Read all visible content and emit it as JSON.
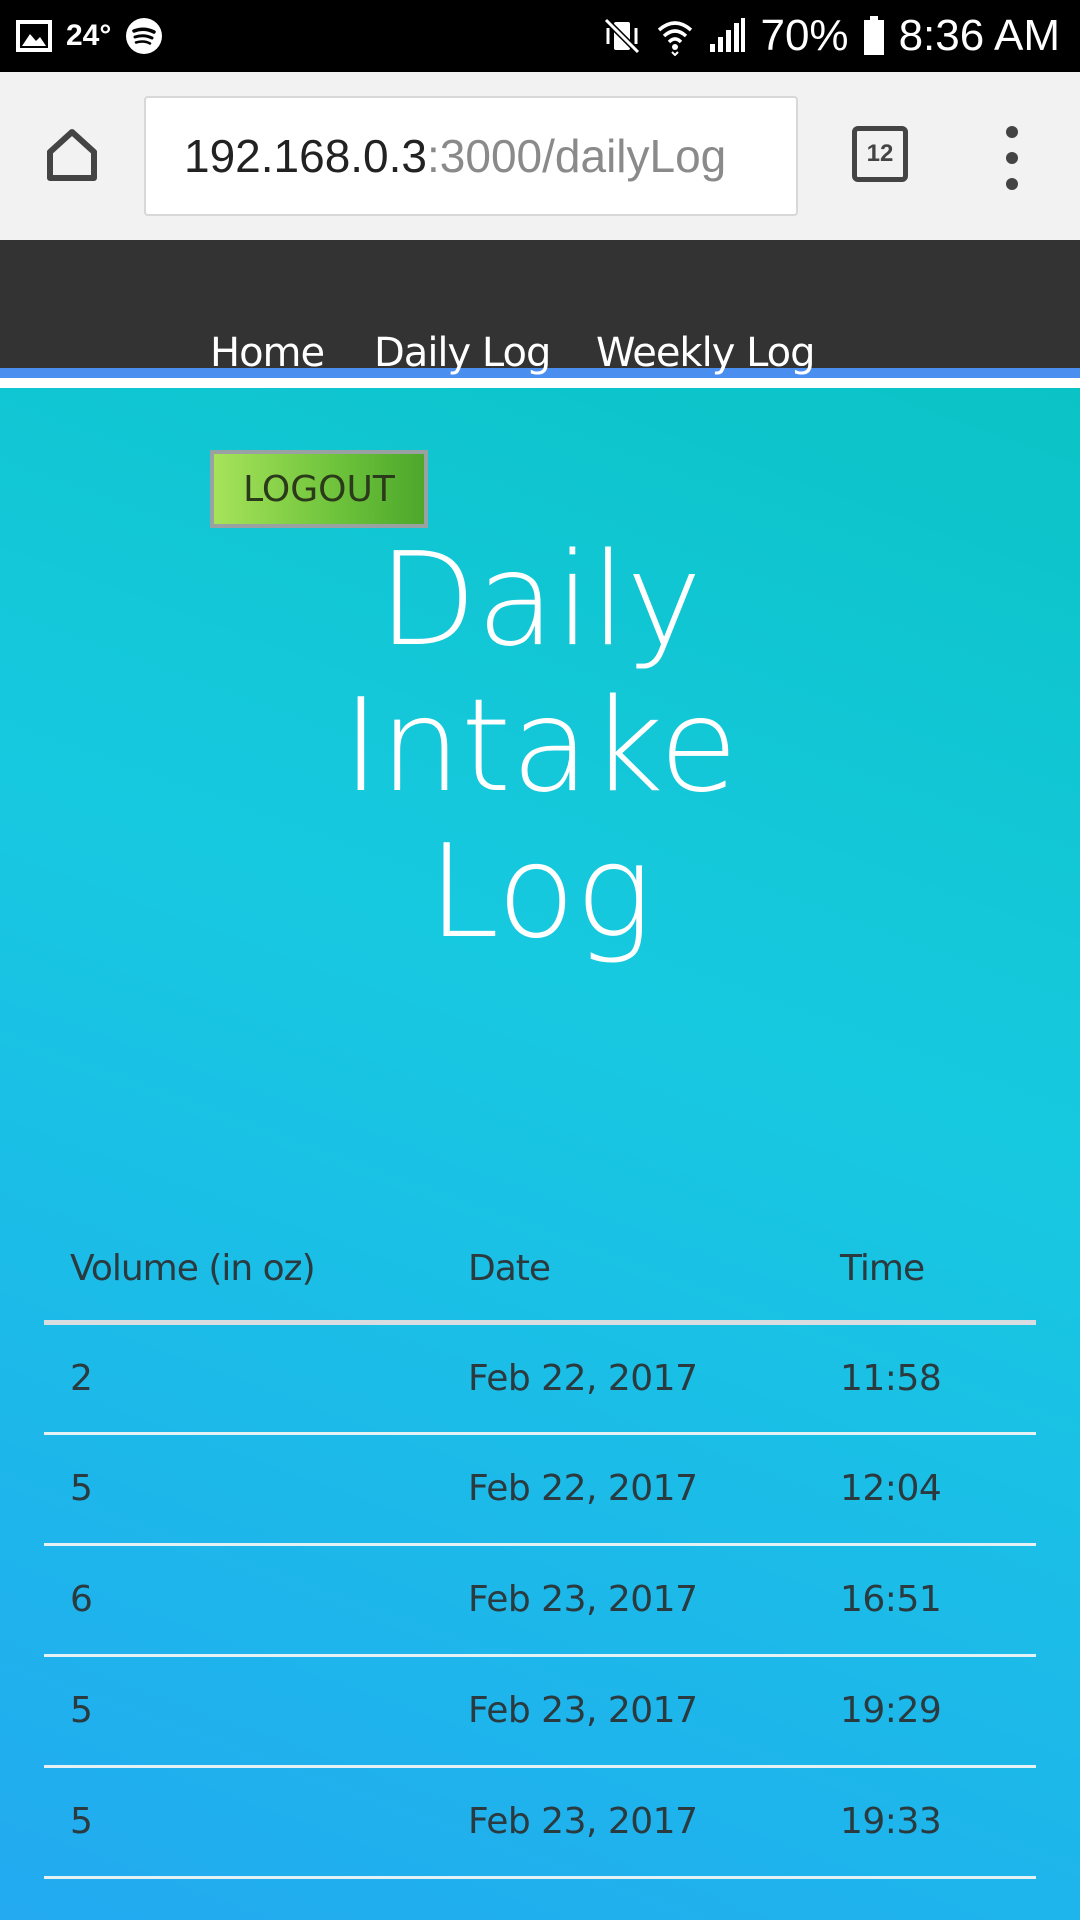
{
  "status_bar": {
    "temperature": "24°",
    "battery": "70%",
    "time": "8:36 AM",
    "icons": [
      "gallery-icon",
      "spotify-icon",
      "vibrate-mute-icon",
      "wifi-icon",
      "signal-icon",
      "battery-icon"
    ]
  },
  "browser": {
    "url_host": "192.168.0.3",
    "url_path": ":3000/dailyLog",
    "tab_count": "12",
    "icons": [
      "home-icon",
      "tabs-icon",
      "overflow-menu-icon"
    ]
  },
  "nav": {
    "items": [
      {
        "label": "Home"
      },
      {
        "label": "Daily Log"
      },
      {
        "label": "Weekly Log"
      }
    ],
    "accent_color": "#4a8ff0",
    "background": "#333333"
  },
  "page": {
    "logout_label": "LOGOUT",
    "title_lines": [
      "Daily",
      "Intake",
      "Log"
    ]
  },
  "table": {
    "headers": [
      "Volume (in oz)",
      "Date",
      "Time"
    ],
    "rows": [
      [
        "2",
        "Feb 22, 2017",
        "11:58"
      ],
      [
        "5",
        "Feb 22, 2017",
        "12:04"
      ],
      [
        "6",
        "Feb 23, 2017",
        "16:51"
      ],
      [
        "5",
        "Feb 23, 2017",
        "19:29"
      ],
      [
        "5",
        "Feb 23, 2017",
        "19:33"
      ]
    ]
  }
}
